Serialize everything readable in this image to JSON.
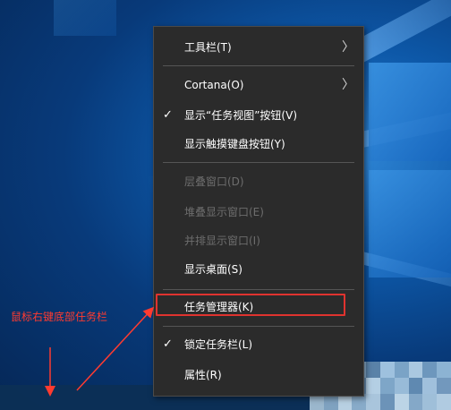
{
  "context_menu": {
    "items": [
      {
        "label": "工具栏(T)",
        "submenu": true,
        "checked": false,
        "enabled": true
      },
      {
        "label": "Cortana(O)",
        "submenu": true,
        "checked": false,
        "enabled": true
      },
      {
        "label": "显示“任务视图”按钮(V)",
        "submenu": false,
        "checked": true,
        "enabled": true
      },
      {
        "label": "显示触摸键盘按钮(Y)",
        "submenu": false,
        "checked": false,
        "enabled": true
      },
      {
        "label": "层叠窗口(D)",
        "submenu": false,
        "checked": false,
        "enabled": false
      },
      {
        "label": "堆叠显示窗口(E)",
        "submenu": false,
        "checked": false,
        "enabled": false
      },
      {
        "label": "并排显示窗口(I)",
        "submenu": false,
        "checked": false,
        "enabled": false
      },
      {
        "label": "显示桌面(S)",
        "submenu": false,
        "checked": false,
        "enabled": true
      },
      {
        "label": "任务管理器(K)",
        "submenu": false,
        "checked": false,
        "enabled": true
      },
      {
        "label": "锁定任务栏(L)",
        "submenu": false,
        "checked": true,
        "enabled": true
      },
      {
        "label": "属性(R)",
        "submenu": false,
        "checked": false,
        "enabled": true
      }
    ],
    "submenu_glyph": "〉",
    "check_glyph": "✓"
  },
  "annotation": {
    "text": "鼠标右键底部任务栏",
    "color": "#ff3b30"
  },
  "highlighted_item": "任务管理器(K)",
  "colors": {
    "menu_background": "#2b2b2b",
    "highlight_border": "#e0332f"
  }
}
